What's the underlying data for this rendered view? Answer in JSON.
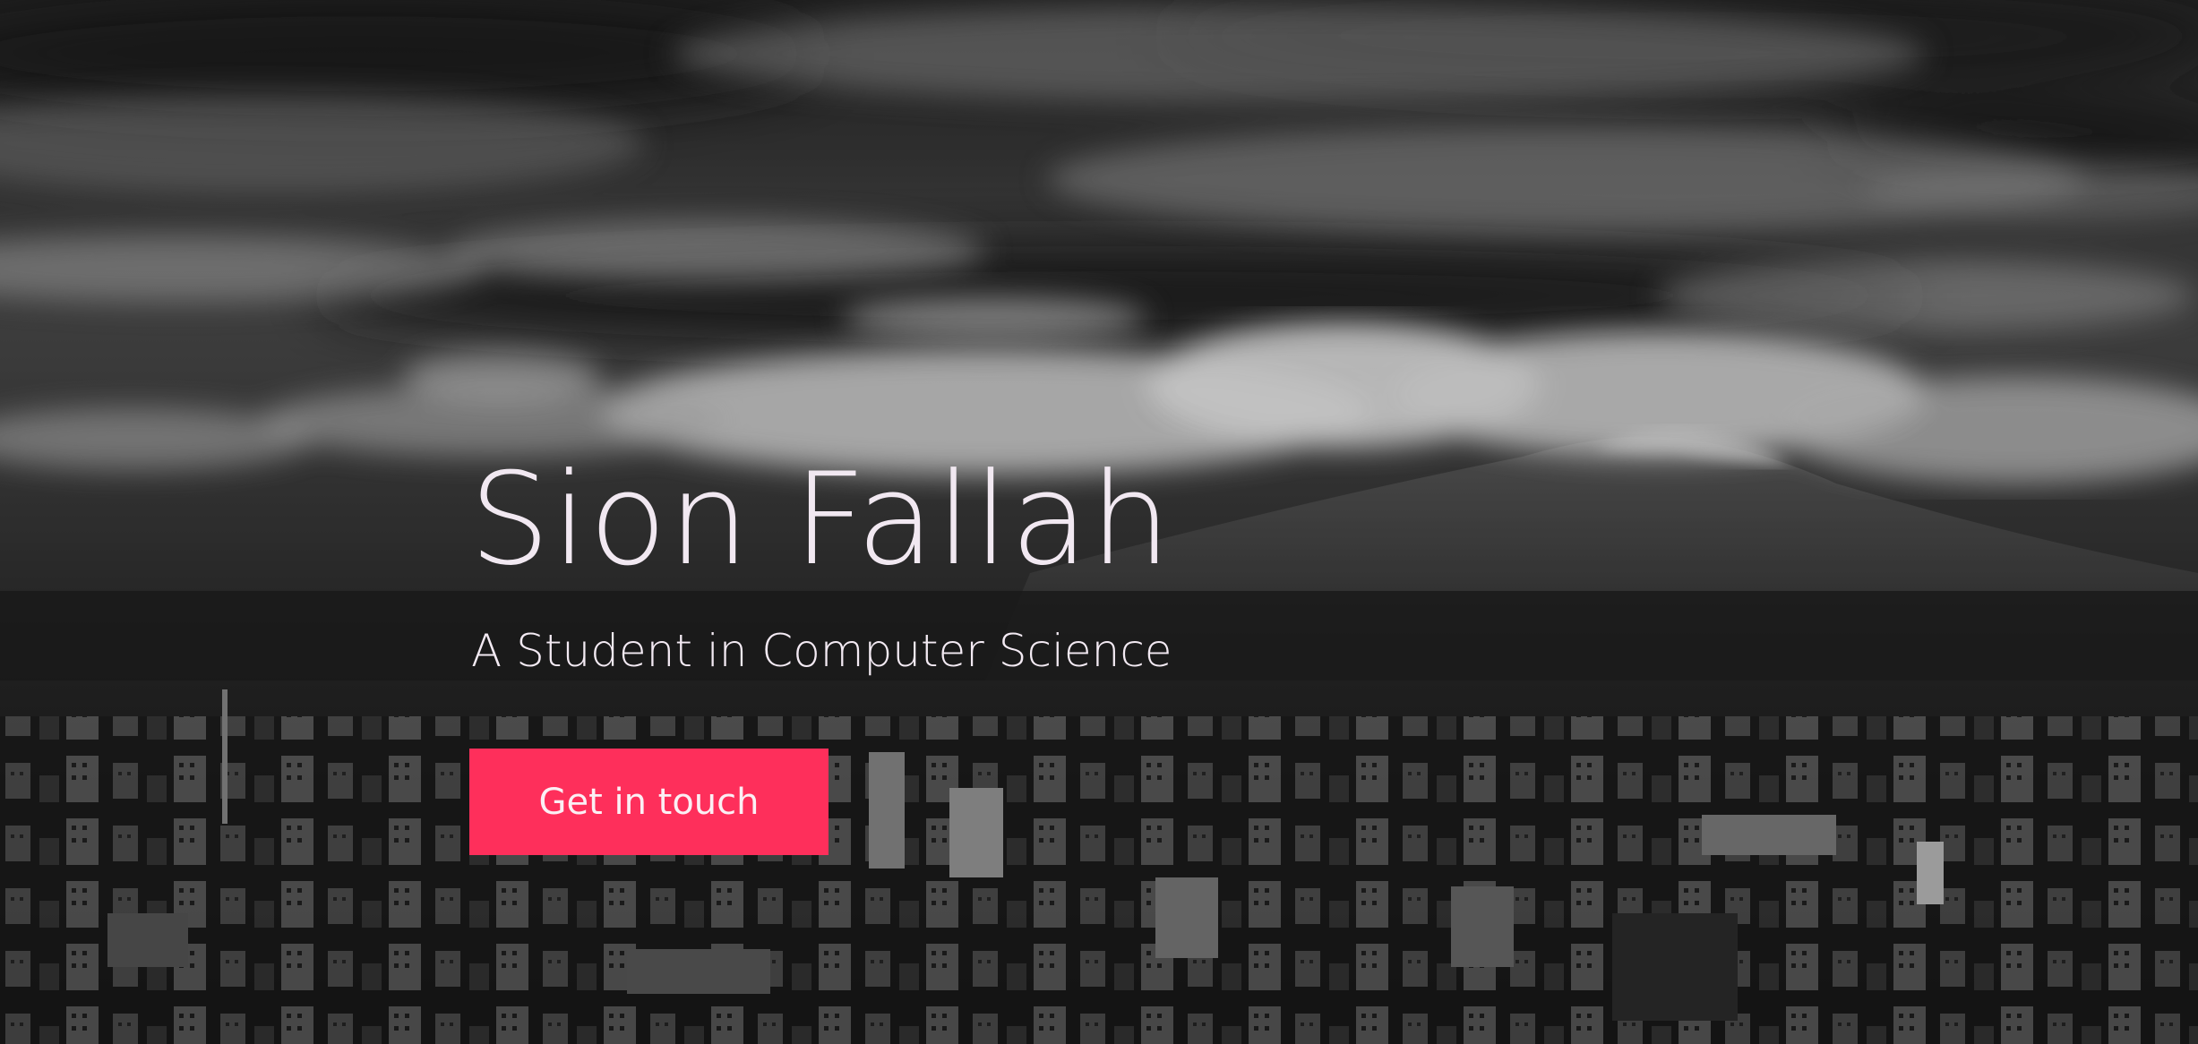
{
  "hero": {
    "name": "Sion Fallah",
    "tagline": "A Student in Computer Science",
    "cta_label": "Get in touch"
  },
  "colors": {
    "accent": "#fe2f5b",
    "text": "#f1e8f1"
  }
}
